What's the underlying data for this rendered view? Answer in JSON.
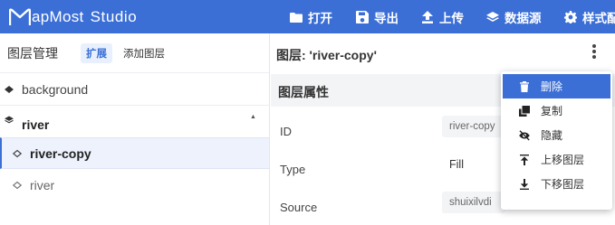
{
  "app": {
    "logo_text": "apMost",
    "logo_studio": "Studio",
    "brand_color": "#3b6fd6"
  },
  "toolbar": {
    "items": [
      {
        "label": "打开",
        "icon": "folder-icon"
      },
      {
        "label": "导出",
        "icon": "save-icon"
      },
      {
        "label": "上传",
        "icon": "upload-icon"
      },
      {
        "label": "数据源",
        "icon": "layers-icon"
      },
      {
        "label": "样式配",
        "icon": "gear-icon"
      }
    ]
  },
  "sidebar": {
    "title": "图层管理",
    "expand_label": "扩展",
    "add_layer_label": "添加图层",
    "layers": [
      {
        "name": "background",
        "icon": "diamond-filled-icon",
        "kind": "layer"
      },
      {
        "name": "river",
        "icon": "layers-stack-icon",
        "kind": "group",
        "expanded": true
      },
      {
        "name": "river-copy",
        "icon": "diamond-outline-icon",
        "kind": "layer",
        "selected": true
      },
      {
        "name": "river",
        "icon": "diamond-outline-icon",
        "kind": "layer"
      }
    ]
  },
  "detail": {
    "title": "图层: 'river-copy'",
    "section_title": "图层属性",
    "properties": [
      {
        "label": "ID",
        "value": "river-copy"
      },
      {
        "label": "Type",
        "value": "Fill"
      },
      {
        "label": "Source",
        "value": "shuixilvdi"
      }
    ]
  },
  "context_menu": {
    "items": [
      {
        "label": "删除",
        "icon": "trash-icon",
        "active": true
      },
      {
        "label": "复制",
        "icon": "copy-icon"
      },
      {
        "label": "隐藏",
        "icon": "eye-off-icon"
      },
      {
        "label": "上移图层",
        "icon": "arrow-up-icon"
      },
      {
        "label": "下移图层",
        "icon": "arrow-down-icon"
      }
    ]
  }
}
